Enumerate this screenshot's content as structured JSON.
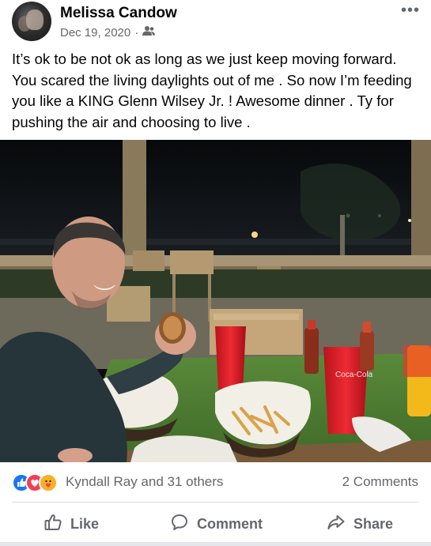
{
  "post": {
    "author": "Melissa Candow",
    "date": "Dec 19, 2020",
    "separator": "·",
    "privacy_icon": "friends-icon",
    "more_label": "•••",
    "text": "It’s ok to be not ok as long as we just keep moving forward. You scared the living daylights out of me . So now I’m feeding you like a KING Glenn Wilsey Jr. ! Awesome dinner . Ty for pushing the air and choosing to live ."
  },
  "photo": {
    "cup_logo": "Coca-Cola"
  },
  "reactions": {
    "icons": [
      "like-reaction-icon",
      "love-reaction-icon",
      "care-reaction-icon"
    ],
    "names": "Kyndall Ray and 31 others",
    "comments": "2 Comments"
  },
  "actions": {
    "like": "Like",
    "comment": "Comment",
    "share": "Share"
  },
  "colors": {
    "link_blue": "#1877f2",
    "secondary_text": "#65676b",
    "love_red": "#f33e58",
    "care_yellow": "#f7b125"
  }
}
